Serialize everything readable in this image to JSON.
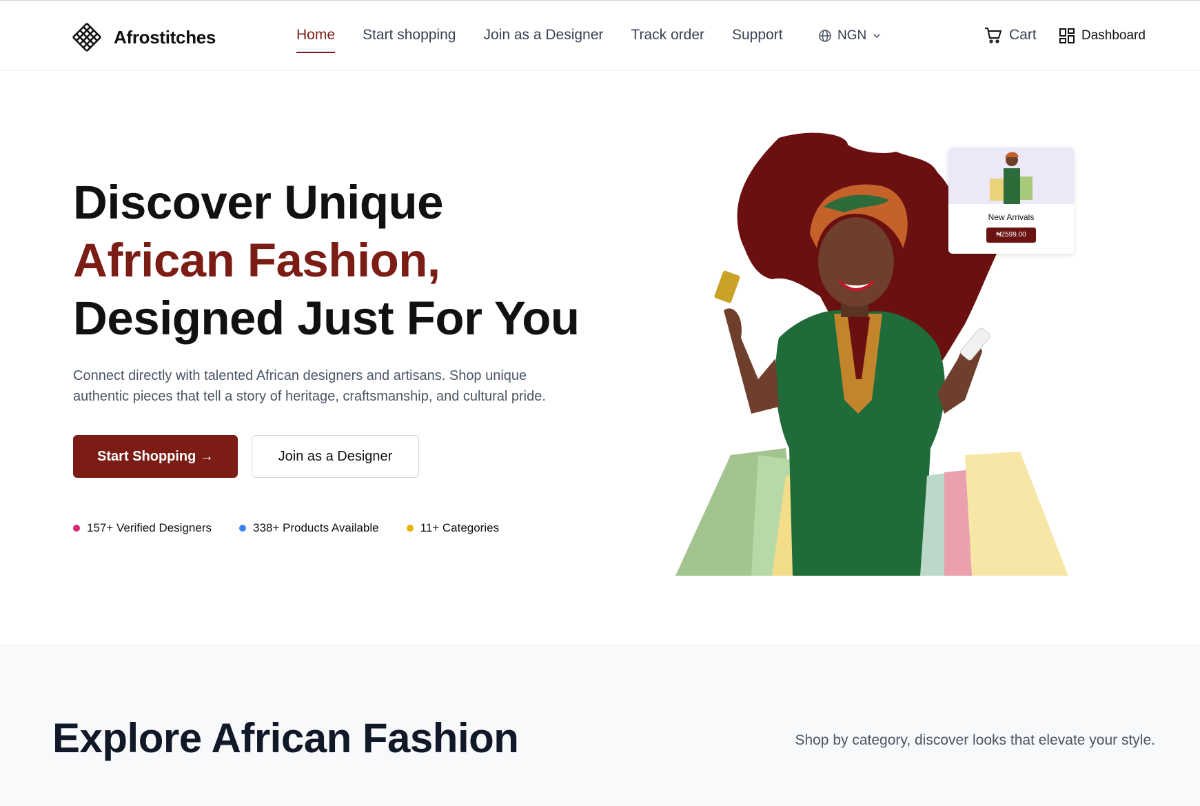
{
  "brand": {
    "name": "Afrostitches"
  },
  "nav": {
    "items": [
      {
        "label": "Home",
        "active": true
      },
      {
        "label": "Start shopping"
      },
      {
        "label": "Join as a Designer"
      },
      {
        "label": "Track order"
      },
      {
        "label": "Support"
      }
    ]
  },
  "currency": {
    "selected": "NGN"
  },
  "header_actions": {
    "cart_label": "Cart",
    "dashboard_label": "Dashboard"
  },
  "hero": {
    "title_line1": "Discover Unique",
    "title_line2": "African Fashion,",
    "title_line3": "Designed Just For You",
    "description": "Connect directly with talented African designers and artisans. Shop unique authentic pieces that tell a story of heritage, craftsmanship, and cultural pride.",
    "primary_button": "Start Shopping →",
    "secondary_button": "Join as a Designer",
    "stats": [
      {
        "label": "157+ Verified Designers",
        "color": "#db2777"
      },
      {
        "label": "338+ Products Available",
        "color": "#3b82f6"
      },
      {
        "label": "11+ Categories",
        "color": "#eab308"
      }
    ]
  },
  "promo_card": {
    "title": "New Arrivals",
    "price": "₦2599.00"
  },
  "explore": {
    "title": "Explore African Fashion",
    "subtitle": "Shop by category, discover looks that elevate your style."
  },
  "colors": {
    "brand": "#7b1c15",
    "africa_map": "#6b1010"
  }
}
